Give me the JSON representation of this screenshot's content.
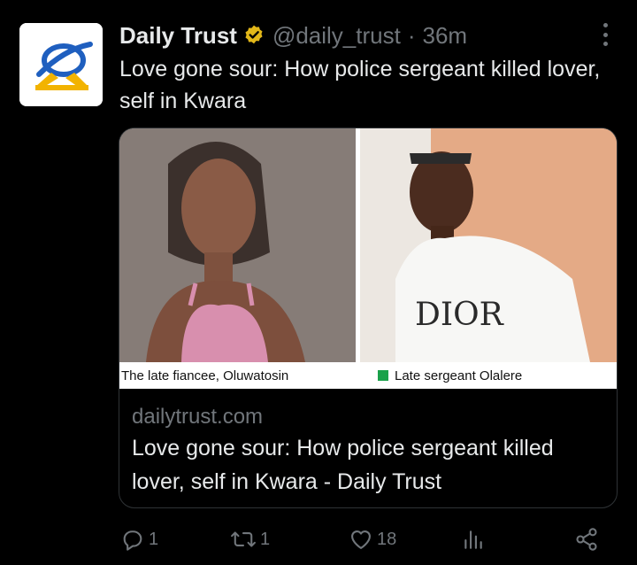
{
  "tweet": {
    "author_name": "Daily Trust",
    "handle": "@daily_trust",
    "separator": "·",
    "time": "36m",
    "text": "Love gone sour: How police sergeant killed lover, self in Kwara"
  },
  "card": {
    "caption_left": "The late fiancee, Oluwatosin",
    "caption_right": "Late sergeant Olalere",
    "shirt_text": "DIOR",
    "domain": "dailytrust.com",
    "title": "Love gone sour: How police sergeant killed lover, self in Kwara - Daily Trust"
  },
  "actions": {
    "reply_count": "1",
    "retweet_count": "1",
    "like_count": "18"
  },
  "colors": {
    "background": "#000000",
    "text_primary": "#e7e9ea",
    "text_secondary": "#71767b",
    "verified_badge": "#e2b719",
    "card_border": "#2f3336",
    "logo_blue": "#1f5fbf",
    "logo_gold": "#f2b300"
  },
  "icons": [
    "verified-badge-icon",
    "more-options-icon",
    "reply-icon",
    "retweet-icon",
    "like-icon",
    "analytics-icon",
    "share-icon"
  ]
}
